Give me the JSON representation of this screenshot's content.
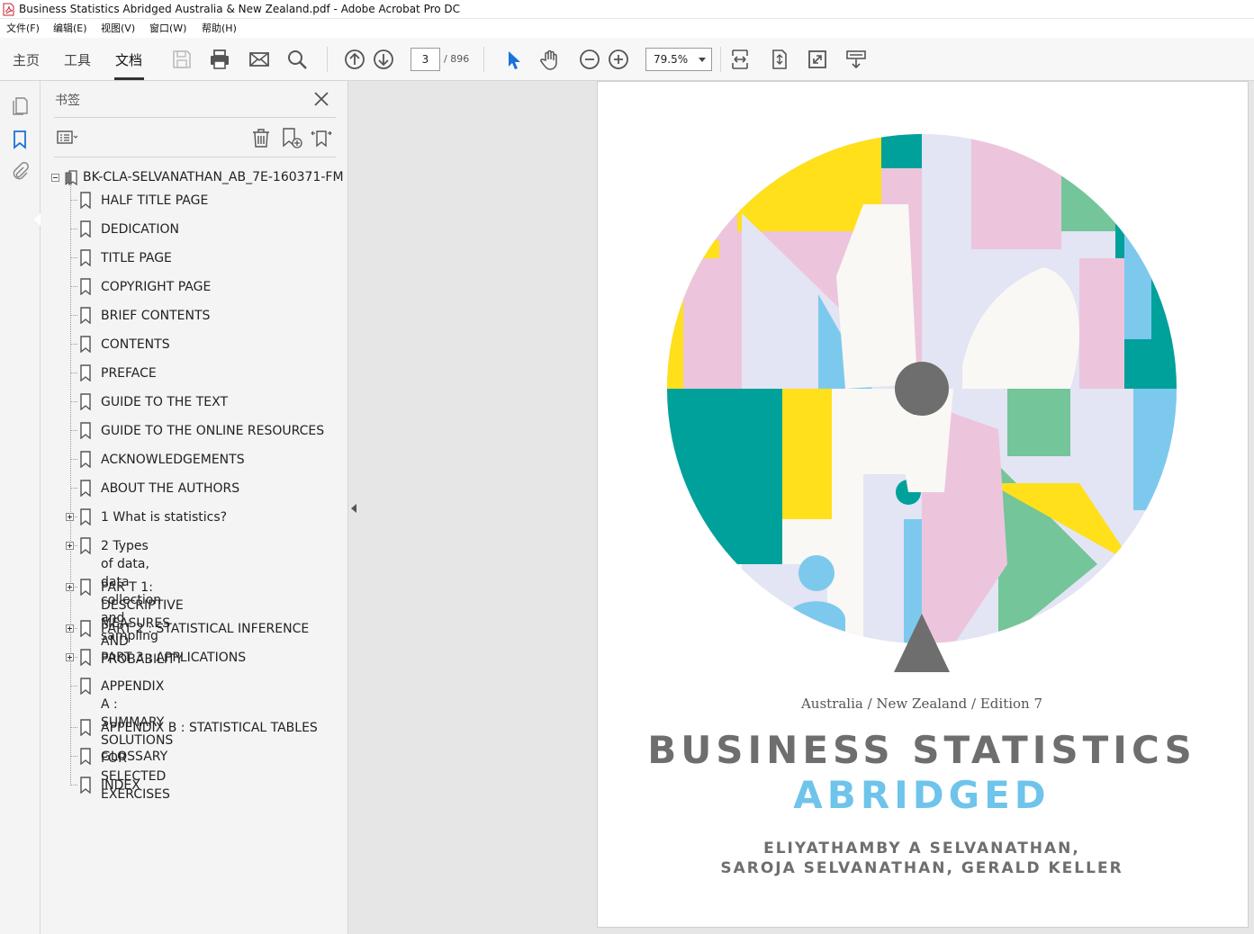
{
  "window": {
    "title": "Business Statistics Abridged Australia & New Zealand.pdf - Adobe Acrobat Pro DC"
  },
  "menu": [
    "文件(F)",
    "编辑(E)",
    "视图(V)",
    "窗口(W)",
    "帮助(H)"
  ],
  "toolbar": {
    "tabs": [
      "主页",
      "工具",
      "文档"
    ],
    "active_tab": "文档",
    "page_current": "3",
    "page_total": "/ 896",
    "zoom": "79.5%",
    "icons": [
      "save-icon",
      "print-icon",
      "email-icon",
      "search-icon",
      "prev-page-icon",
      "next-page-icon",
      "select-cursor-icon",
      "hand-tool-icon",
      "zoom-out-icon",
      "zoom-in-icon",
      "fit-width-icon",
      "fit-page-icon",
      "fullscreen-icon",
      "read-mode-icon"
    ]
  },
  "left_rail": {
    "icons": [
      "page-thumbnails-icon",
      "bookmarks-icon",
      "attachments-icon"
    ]
  },
  "bookmarks_panel": {
    "title": "书签",
    "root": "BK-CLA-SELVANATHAN_AB_7E-160371-FM",
    "items": [
      {
        "label": "HALF TITLE PAGE",
        "expandable": false
      },
      {
        "label": "DEDICATION",
        "expandable": false
      },
      {
        "label": "TITLE PAGE",
        "expandable": false
      },
      {
        "label": "COPYRIGHT PAGE",
        "expandable": false
      },
      {
        "label": "BRIEF CONTENTS",
        "expandable": false
      },
      {
        "label": "CONTENTS",
        "expandable": false
      },
      {
        "label": "PREFACE",
        "expandable": false
      },
      {
        "label": "GUIDE TO THE TEXT",
        "expandable": false
      },
      {
        "label": "GUIDE TO THE ONLINE RESOURCES",
        "expandable": false
      },
      {
        "label": "ACKNOWLEDGEMENTS",
        "expandable": false
      },
      {
        "label": "ABOUT THE AUTHORS",
        "expandable": false
      },
      {
        "label": "1 What is statistics?",
        "expandable": true
      },
      {
        "label_line1": "2 Types of data, data collection and",
        "label_line2": "sampling",
        "expandable": true
      },
      {
        "label_line1": "PAR T 1: DESCRIPTIVE MEASURES AND",
        "label_line2": "PROBABILITY",
        "expandable": true
      },
      {
        "label": "PART 2 : STATISTICAL INFERENCE",
        "expandable": true
      },
      {
        "label": "PART 3 : APPLICATIONS",
        "expandable": true
      },
      {
        "label_line1": "APPENDIX A : SUMMARY SOLUTIONS",
        "label_line2": "FOR SELECTED EXERCISES",
        "expandable": false
      },
      {
        "label": "APPENDIX B : STATISTICAL TABLES",
        "expandable": false
      },
      {
        "label": "GLOSSARY",
        "expandable": false
      },
      {
        "label": "INDEX",
        "expandable": false
      }
    ]
  },
  "document": {
    "edition": "Australia / New Zealand / Edition 7",
    "title_line1": "BUSINESS STATISTICS",
    "title_line2": "ABRIDGED",
    "authors_line1": "ELIYATHAMBY A SELVANATHAN,",
    "authors_line2": "SAROJA SELVANATHAN, GERALD KELLER",
    "colors": {
      "yellow": "#ffe01a",
      "teal": "#00a19a",
      "pink": "#ecc5dc",
      "sky": "#7dc9ee",
      "green": "#74c59a",
      "lavender": "#e3e4f4",
      "cream": "#f9f8f4",
      "grey": "#6e6e6e"
    }
  }
}
